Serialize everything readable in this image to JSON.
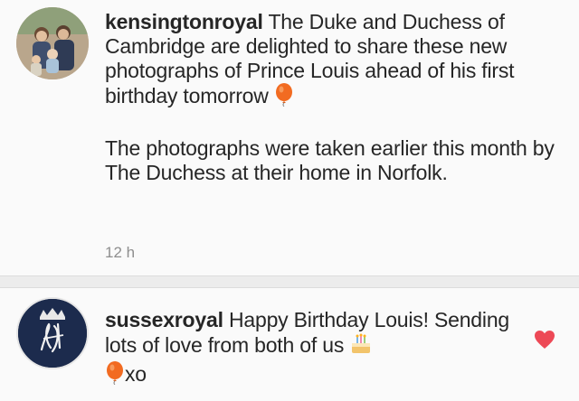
{
  "post": {
    "username": "kensingtonroyal",
    "caption_line1": "The Duke and Duchess of Cambridge are delighted to share these new photographs of Prince Louis ahead of his first birthday tomorrow",
    "caption_emoji": "balloon-icon",
    "caption_para2": "The photographs were taken earlier this month by The Duchess at their home in Norfolk.",
    "timestamp": "12 h"
  },
  "comment": {
    "username": "sussexroyal",
    "text": "Happy Birthday Louis! Sending lots of love from both of us",
    "emoji1": "cake-icon",
    "emoji2": "balloon-icon",
    "sign_off": "xo",
    "liked": true,
    "heart_color": "#ed4956"
  },
  "colors": {
    "text": "#262626",
    "timestamp": "#8e8e8e",
    "balloon": "#f26b21"
  }
}
